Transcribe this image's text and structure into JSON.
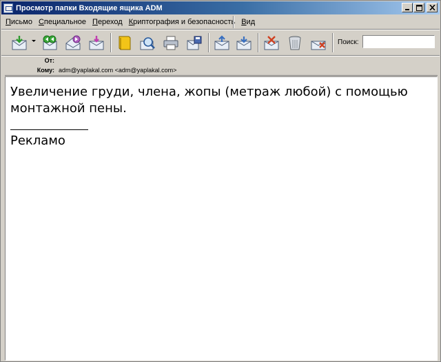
{
  "window": {
    "title": "Просмотр папки Входящие ящика ADM",
    "buttons": {
      "minimize": "_",
      "maximize": "□",
      "close": "×"
    }
  },
  "menu": {
    "items": [
      {
        "label": "Письмо",
        "underline": "П",
        "rest": "исьмо"
      },
      {
        "label": "Специальное",
        "underline": "С",
        "rest": "пециальное"
      },
      {
        "label": "Переход",
        "underline": "П",
        "rest": "ереход"
      },
      {
        "label": "Криптография и безопасность",
        "underline": "К",
        "rest": "риптография и безопасность"
      },
      {
        "label": "Вид",
        "underline": "В",
        "rest": "ид"
      }
    ]
  },
  "toolbar": {
    "buttons": [
      {
        "name": "get-mail",
        "icon": "envelope-down-icon"
      },
      {
        "name": "reply",
        "icon": "reply-icon"
      },
      {
        "name": "forward",
        "icon": "forward-icon"
      },
      {
        "name": "compose",
        "icon": "compose-icon"
      },
      {
        "name": "address-book",
        "icon": "book-icon"
      },
      {
        "name": "search-mail",
        "icon": "magnifier-icon"
      },
      {
        "name": "print",
        "icon": "printer-icon"
      },
      {
        "name": "save",
        "icon": "save-icon"
      },
      {
        "name": "previous",
        "icon": "up-arrow-icon"
      },
      {
        "name": "next",
        "icon": "down-arrow-icon"
      },
      {
        "name": "mark-junk",
        "icon": "junk-icon"
      },
      {
        "name": "delete",
        "icon": "trash-icon"
      },
      {
        "name": "stop",
        "icon": "cancel-icon"
      }
    ],
    "search_label": "Поиск:",
    "search_value": ""
  },
  "headers": {
    "from_label": "От:",
    "from_value": "",
    "to_label": "Кому:",
    "to_value": "adm@yaplakal.com <adm@yaplakal.com>"
  },
  "message": {
    "line1": "Увеличение груди, члена, жопы (метраж любой) с помощью",
    "line2": "монтажной пены.",
    "signature": "Рекламо"
  },
  "colors": {
    "title_start": "#0a246a",
    "title_end": "#a6caf0",
    "chrome": "#d4d0c8"
  }
}
